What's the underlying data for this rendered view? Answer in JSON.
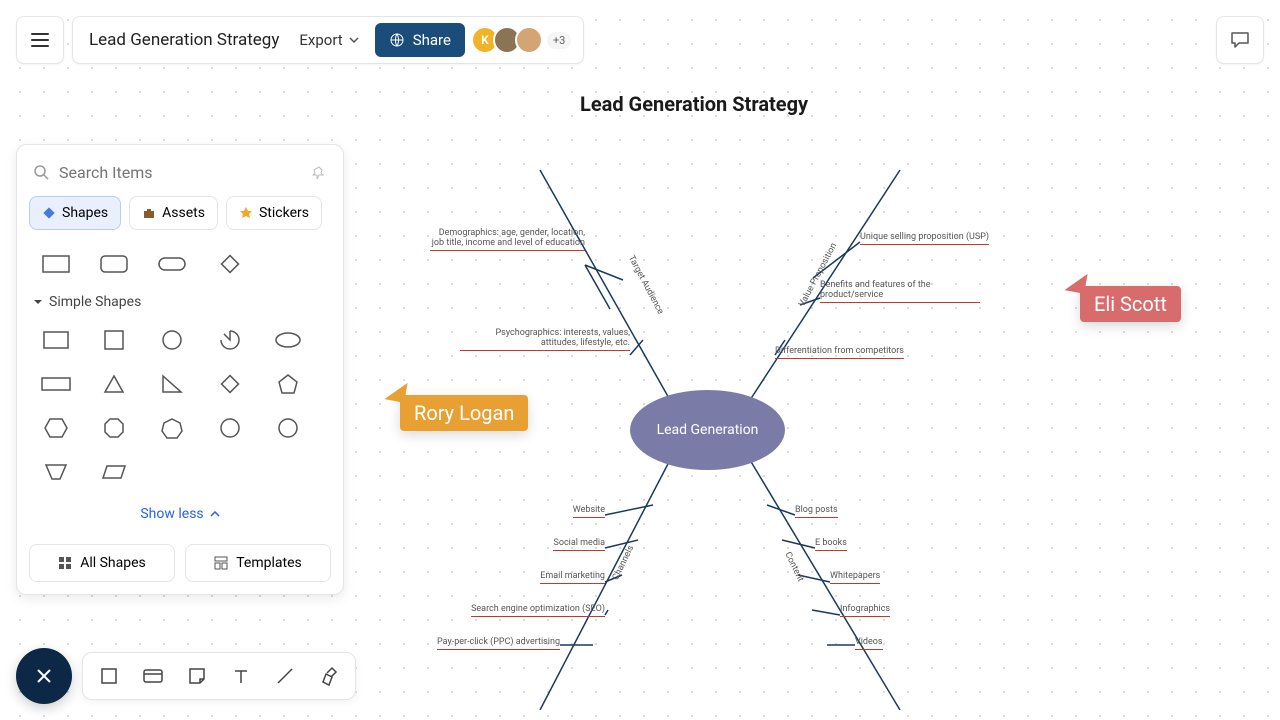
{
  "doc": {
    "title": "Lead Generation Strategy"
  },
  "toolbar": {
    "export": "Export",
    "share": "Share",
    "avatar1": "K",
    "more_count": "+3"
  },
  "panel": {
    "search_placeholder": "Search Items",
    "tab_shapes": "Shapes",
    "tab_assets": "Assets",
    "tab_stickers": "Stickers",
    "section_simple": "Simple Shapes",
    "show_less": "Show less",
    "all_shapes": "All Shapes",
    "templates": "Templates"
  },
  "canvas": {
    "title": "Lead Generation Strategy",
    "center": "Lead Generation",
    "branches": {
      "target_audience": {
        "label": "Target Audience",
        "items": [
          "Demographics: age, gender, location, job title, income and level of education",
          "Psychographics: interests, values, attitudes, lifestyle, etc."
        ]
      },
      "value_proposition": {
        "label": "Value Proposition",
        "items": [
          "Unique selling proposition (USP)",
          "Benefits and features of the product/service",
          "Differentiation from competitors"
        ]
      },
      "channels": {
        "label": "Channels",
        "items": [
          "Website",
          "Social media",
          "Email marketing",
          "Search engine optimization (SEO)",
          "Pay-per-click (PPC) advertising"
        ]
      },
      "content": {
        "label": "Content",
        "items": [
          "Blog posts",
          "E books",
          "Whitepapers",
          "Infographics",
          "Videos"
        ]
      }
    }
  },
  "cursors": {
    "user1": "Rory Logan",
    "user2": "Eli Scott"
  }
}
